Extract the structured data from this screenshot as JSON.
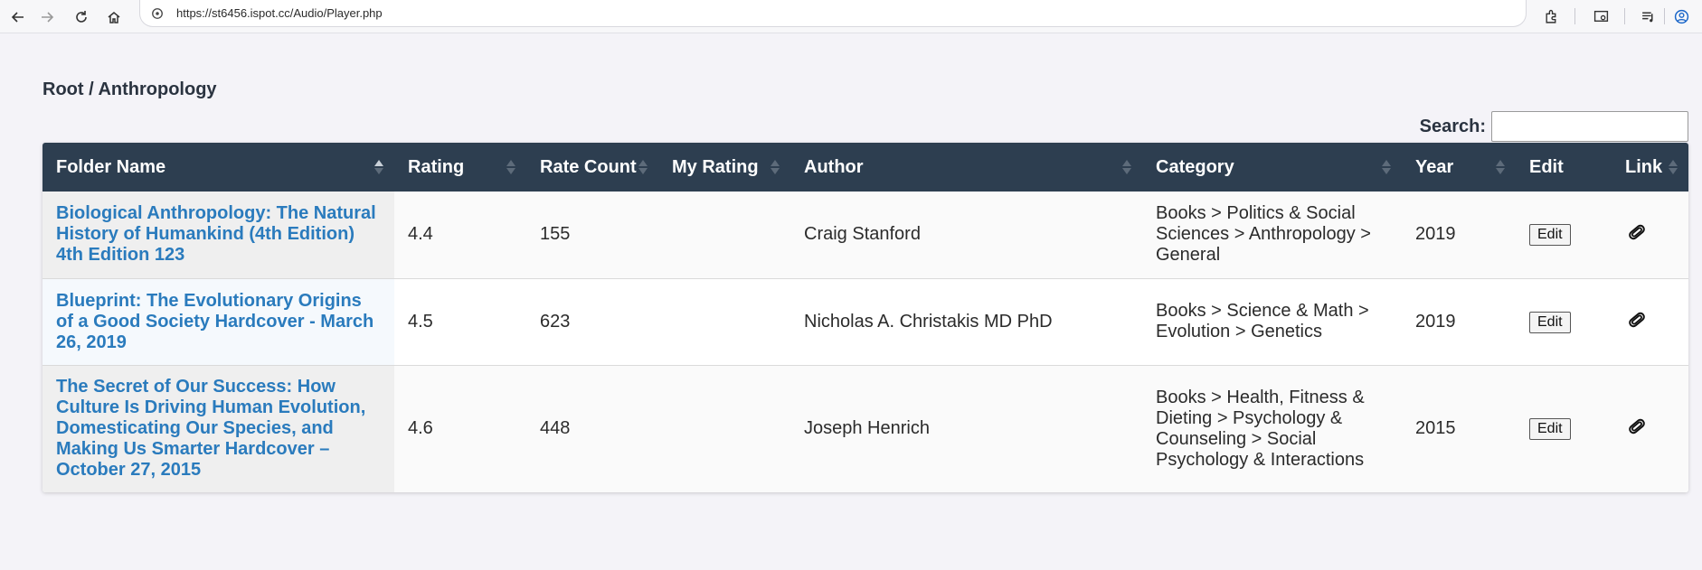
{
  "browser": {
    "url": "https://st6456.ispot.cc/Audio/Player.php"
  },
  "page": {
    "breadcrumb": "Root / Anthropology",
    "search_label": "Search:",
    "search_value": ""
  },
  "table": {
    "headers": {
      "folder": "Folder Name",
      "rating": "Rating",
      "rate_count": "Rate Count",
      "my_rating": "My Rating",
      "author": "Author",
      "category": "Category",
      "year": "Year",
      "edit": "Edit",
      "link": "Link"
    },
    "rows": [
      {
        "folder": "Biological Anthropology: The Natural History of Humankind (4th Edition) 4th Edition 123",
        "rating": "4.4",
        "rate_count": "155",
        "my_rating": "",
        "author": "Craig Stanford",
        "category": "Books > Politics & Social Sciences > Anthropology > General",
        "year": "2019",
        "edit": "Edit"
      },
      {
        "folder": "Blueprint: The Evolutionary Origins of a Good Society Hardcover - March 26, 2019",
        "rating": "4.5",
        "rate_count": "623",
        "my_rating": "",
        "author": "Nicholas A. Christakis MD PhD",
        "category": "Books > Science & Math > Evolution > Genetics",
        "year": "2019",
        "edit": "Edit"
      },
      {
        "folder": "The Secret of Our Success: How Culture Is Driving Human Evolution, Domesticating Our Species, and Making Us Smarter Hardcover – October 27, 2015",
        "rating": "4.6",
        "rate_count": "448",
        "my_rating": "",
        "author": "Joseph Henrich",
        "category": "Books > Health, Fitness & Dieting > Psychology & Counseling > Social Psychology & Interactions",
        "year": "2015",
        "edit": "Edit"
      }
    ]
  },
  "icons": {
    "back": "arrow-left-icon",
    "forward": "arrow-right-icon",
    "reload": "reload-icon",
    "home": "home-icon",
    "site": "site-info-icon",
    "link": "paperclip-icon"
  },
  "colors": {
    "header_bg": "#2d3e50",
    "link": "#2a7bbd",
    "page_bg": "#f4f3f8"
  }
}
